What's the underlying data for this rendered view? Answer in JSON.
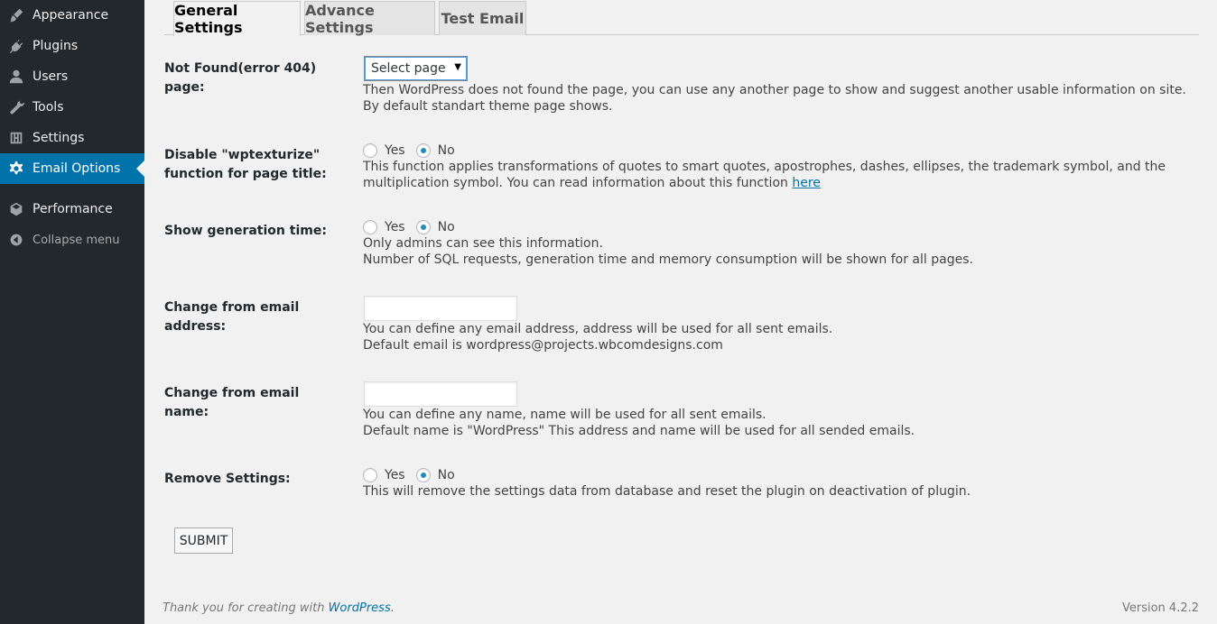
{
  "sidebar": {
    "items": [
      {
        "label": "Appearance",
        "icon": "brush-icon"
      },
      {
        "label": "Plugins",
        "icon": "plug-icon"
      },
      {
        "label": "Users",
        "icon": "user-icon"
      },
      {
        "label": "Tools",
        "icon": "wrench-icon"
      },
      {
        "label": "Settings",
        "icon": "sliders-icon"
      },
      {
        "label": "Email Options",
        "icon": "gear-icon",
        "active": true
      },
      {
        "label": "Performance",
        "icon": "cube-icon"
      },
      {
        "label": "Collapse menu",
        "icon": "collapse-arrow-icon"
      }
    ]
  },
  "tabs": [
    {
      "label": "General Settings",
      "active": true
    },
    {
      "label": "Advance Settings"
    },
    {
      "label": "Test Email"
    }
  ],
  "form": {
    "not_found": {
      "label": "Not Found(error 404) page:",
      "select_value": "Select page",
      "desc": "Then WordPress does not found the page, you can use any another page to show and suggest another usable information on site. By default standart theme page shows."
    },
    "wptexturize": {
      "label": "Disable \"wptexturize\" function for page title:",
      "yes": "Yes",
      "no": "No",
      "selected": "No",
      "desc": "This function applies transformations of quotes to smart quotes, apostrophes, dashes, ellipses, the trademark symbol, and the multiplication symbol. You can read information about this function ",
      "link": "here"
    },
    "generation_time": {
      "label": "Show generation time:",
      "yes": "Yes",
      "no": "No",
      "selected": "No",
      "desc_line1": "Only admins can see this information.",
      "desc_line2": "Number of SQL requests, generation time and memory consumption will be shown for all pages."
    },
    "from_email": {
      "label": "Change from email address:",
      "value": "",
      "desc_line1": "You can define any email address, address will be used for all sent emails.",
      "desc_line2": "Default email is wordpress@projects.wbcomdesigns.com"
    },
    "from_name": {
      "label": "Change from email name:",
      "value": "",
      "desc_line1": "You can define any name, name will be used for all sent emails.",
      "desc_line2": "Default name is \"WordPress\" This address and name will be used for all sended emails."
    },
    "remove_settings": {
      "label": "Remove Settings:",
      "yes": "Yes",
      "no": "No",
      "selected": "No",
      "desc": "This will remove the settings data from database and reset the plugin on deactivation of plugin."
    },
    "submit_label": "SUBMIT"
  },
  "footer": {
    "thanks_prefix": "Thank you for creating with ",
    "thanks_link": "WordPress",
    "thanks_suffix": ".",
    "version": "Version 4.2.2"
  },
  "colors": {
    "sidebar_bg": "#23282d",
    "active_bg": "#0073aa",
    "link": "#0073aa",
    "page_bg": "#f1f1f1"
  }
}
